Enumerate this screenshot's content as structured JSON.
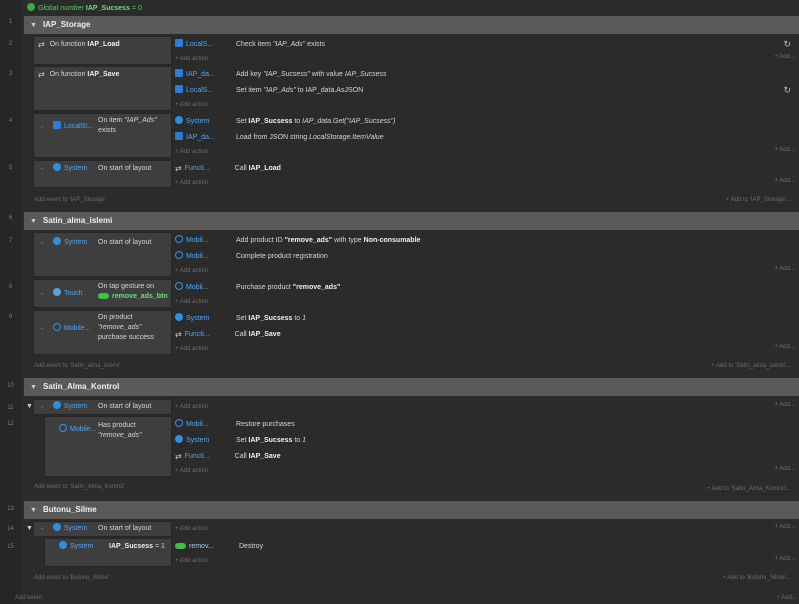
{
  "line_numbers": [
    "1",
    "2",
    "3",
    "4",
    "5",
    "6",
    "7",
    "8",
    "9",
    "10",
    "11",
    "12",
    "13",
    "14",
    "15"
  ],
  "top": {
    "prefix": "Global number",
    "name": "IAP_Sucsess",
    "suffix": "= 0"
  },
  "common": {
    "add_action": "+ Add action",
    "add_right": "+ Add...",
    "arrow": "→",
    "collapse": "▼"
  },
  "g1": {
    "title": "IAP_Storage",
    "e2_cond": "On function",
    "e2_cond_b": "IAP_Load",
    "e2_a1_obj": "LocalS...",
    "e2_a1": "Check item",
    "e2_a1_i": "\"IAP_Ads\"",
    "e2_a1_end": "exists",
    "e3_cond": "On function",
    "e3_cond_b": "IAP_Save",
    "e3_a1_obj": "IAP_da...",
    "e3_a1": "Add key",
    "e3_a1_i": "\"IAP_Sucsess\"",
    "e3_a1_mid": "with value",
    "e3_a1_i2": "IAP_Sucsess",
    "e3_a2_obj": "LocalS...",
    "e3_a2": "Set item",
    "e3_a2_i": "\"IAP_Ads\"",
    "e3_a2_end": "to IAP_data.AsJSON",
    "e4_obj": "LocalSt...",
    "e4_cond": "On item",
    "e4_cond_i": "\"IAP_Ads\"",
    "e4_cond2": "exists",
    "e4_a1_obj": "System",
    "e4_a1": "Set",
    "e4_a1_b": "IAP_Sucsess",
    "e4_a1_mid": "to",
    "e4_a1_i": "IAP_data.Get(\"IAP_Sucsess\")",
    "e4_a2_obj": "IAP_da...",
    "e4_a2": "Load from JSON string",
    "e4_a2_i": "LocalStorage.ItemValue",
    "e5_obj": "System",
    "e5_cond": "On start of layout",
    "e5_a1_obj": "Functi...",
    "e5_a1": "Call",
    "e5_a1_b": "IAP_Load",
    "add_event": "Add event to 'IAP_Storage'",
    "add_event_r": "+ Add to 'IAP_Storage'..."
  },
  "g2": {
    "title": "Satin_alma_islemi",
    "e7_obj": "System",
    "e7_cond": "On start of layout",
    "e7_a1_obj": "Mobil...",
    "e7_a1": "Add product ID",
    "e7_a1_b": "\"remove_ads\"",
    "e7_a1_mid": "with type",
    "e7_a1_b2": "Non-consumable",
    "e7_a2_obj": "Mobil...",
    "e7_a2": "Complete product registration",
    "e8_obj": "Touch",
    "e8_cond": "On tap gesture on",
    "e8_cond_obj": "remove_ads_btn",
    "e8_a1_obj": "Mobil...",
    "e8_a1": "Purchase product",
    "e8_a1_b": "\"remove_ads\"",
    "e9_obj": "Mobile...",
    "e9_cond1": "On product",
    "e9_cond2": "\"remove_ads\"",
    "e9_cond3": "purchase success",
    "e9_a1_obj": "System",
    "e9_a1": "Set",
    "e9_a1_b": "IAP_Sucsess",
    "e9_a1_mid": "to",
    "e9_a1_i": "1",
    "e9_a2_obj": "Functi...",
    "e9_a2": "Call",
    "e9_a2_b": "IAP_Save",
    "add_event": "Add event to 'Satin_alma_islemi'",
    "add_event_r": "+ Add to 'Satin_alma_islemi'..."
  },
  "g3": {
    "title": "Satin_Alma_Kontrol",
    "e11_obj": "System",
    "e11_cond": "On start of layout",
    "e12_obj": "Mobile...",
    "e12_cond1": "Has product",
    "e12_cond2": "\"remove_ads\"",
    "e12_a1_obj": "Mobil...",
    "e12_a1": "Restore purchases",
    "e12_a2_obj": "System",
    "e12_a2": "Set",
    "e12_a2_b": "IAP_Sucsess",
    "e12_a2_mid": "to",
    "e12_a2_i": "1",
    "e12_a3_obj": "Functi...",
    "e12_a3": "Call",
    "e12_a3_b": "IAP_Save",
    "add_event": "Add event to 'Satin_Alma_Kontrol'",
    "add_event_r": "+ Add to 'Satin_Alma_Kontrol'..."
  },
  "g4": {
    "title": "Butonu_Silme",
    "e14_obj": "System",
    "e14_cond": "On start of layout",
    "e15_obj": "System",
    "e15_cond_b": "IAP_Sucsess",
    "e15_cond": "= 1",
    "e15_a1_obj": "remov...",
    "e15_a1": "Destroy",
    "add_event": "Add event to 'Butonu_Silme'",
    "add_event_r": "+ Add to 'Butonu_Silme'..."
  },
  "footer": {
    "add_event": "Add event",
    "add_right": "+ Add..."
  }
}
